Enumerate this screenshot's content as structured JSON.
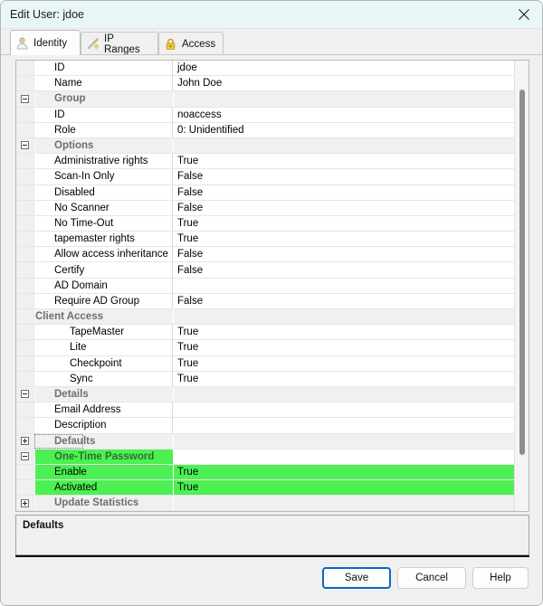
{
  "window": {
    "title": "Edit User: jdoe",
    "close_icon": "close-icon"
  },
  "tabs": [
    {
      "label": "Identity",
      "icon": "user-icon",
      "active": true
    },
    {
      "label": "IP Ranges",
      "icon": "wand-icon",
      "active": false
    },
    {
      "label": "Access",
      "icon": "padlock-icon",
      "active": false
    }
  ],
  "grid": {
    "rows": [
      {
        "type": "prop",
        "level": 0,
        "name": "ID",
        "value": "jdoe"
      },
      {
        "type": "prop",
        "level": 0,
        "name": "Name",
        "value": "John Doe"
      },
      {
        "type": "cat",
        "level": 0,
        "name": "Group",
        "value": "",
        "expander": "minus"
      },
      {
        "type": "prop",
        "level": 0,
        "name": "ID",
        "value": "noaccess"
      },
      {
        "type": "prop",
        "level": 0,
        "name": "Role",
        "value": "0: Unidentified"
      },
      {
        "type": "cat",
        "level": 0,
        "name": "Options",
        "value": "",
        "expander": "minus"
      },
      {
        "type": "prop",
        "level": 0,
        "name": "Administrative rights",
        "value": "True"
      },
      {
        "type": "prop",
        "level": 0,
        "name": "Scan-In Only",
        "value": "False"
      },
      {
        "type": "prop",
        "level": 0,
        "name": "Disabled",
        "value": "False"
      },
      {
        "type": "prop",
        "level": 0,
        "name": "No Scanner",
        "value": "False"
      },
      {
        "type": "prop",
        "level": 0,
        "name": "No Time-Out",
        "value": "True"
      },
      {
        "type": "prop",
        "level": 0,
        "name": "tapemaster rights",
        "value": "True"
      },
      {
        "type": "prop",
        "level": 0,
        "name": "Allow access inheritance",
        "value": "False"
      },
      {
        "type": "prop",
        "level": 0,
        "name": "Certify",
        "value": "False"
      },
      {
        "type": "prop",
        "level": 0,
        "name": "AD Domain",
        "value": ""
      },
      {
        "type": "prop",
        "level": 0,
        "name": "Require AD Group",
        "value": "False"
      },
      {
        "type": "cat",
        "level": 1,
        "name": "Client Access",
        "value": "",
        "expander": "minus"
      },
      {
        "type": "prop",
        "level": 1,
        "name": "TapeMaster",
        "value": "True"
      },
      {
        "type": "prop",
        "level": 1,
        "name": "Lite",
        "value": "True"
      },
      {
        "type": "prop",
        "level": 1,
        "name": "Checkpoint",
        "value": "True"
      },
      {
        "type": "prop",
        "level": 1,
        "name": "Sync",
        "value": "True"
      },
      {
        "type": "cat",
        "level": 0,
        "name": "Details",
        "value": "",
        "expander": "minus"
      },
      {
        "type": "prop",
        "level": 0,
        "name": "Email Address",
        "value": ""
      },
      {
        "type": "prop",
        "level": 0,
        "name": "Description",
        "value": ""
      },
      {
        "type": "cat",
        "level": 0,
        "name": "Defaults",
        "value": "",
        "expander": "plus",
        "focused": true
      },
      {
        "type": "cat",
        "level": 0,
        "name": "One-Time Password",
        "value": "",
        "expander": "minus",
        "highlight": true
      },
      {
        "type": "prop",
        "level": 0,
        "name": "Enable",
        "value": "True",
        "highlight": true
      },
      {
        "type": "prop",
        "level": 0,
        "name": "Activated",
        "value": "True",
        "highlight": true
      },
      {
        "type": "cat",
        "level": 0,
        "name": "Update Statistics",
        "value": "",
        "expander": "plus"
      }
    ]
  },
  "description": {
    "title": "Defaults",
    "text": ""
  },
  "footer": {
    "save_label": "Save",
    "cancel_label": "Cancel",
    "help_label": "Help"
  },
  "colors": {
    "titlebar": "#e9f6f8",
    "highlight_green": "#4df052",
    "accent_blue": "#0a66c2",
    "category_text": "#6e6e6e"
  }
}
